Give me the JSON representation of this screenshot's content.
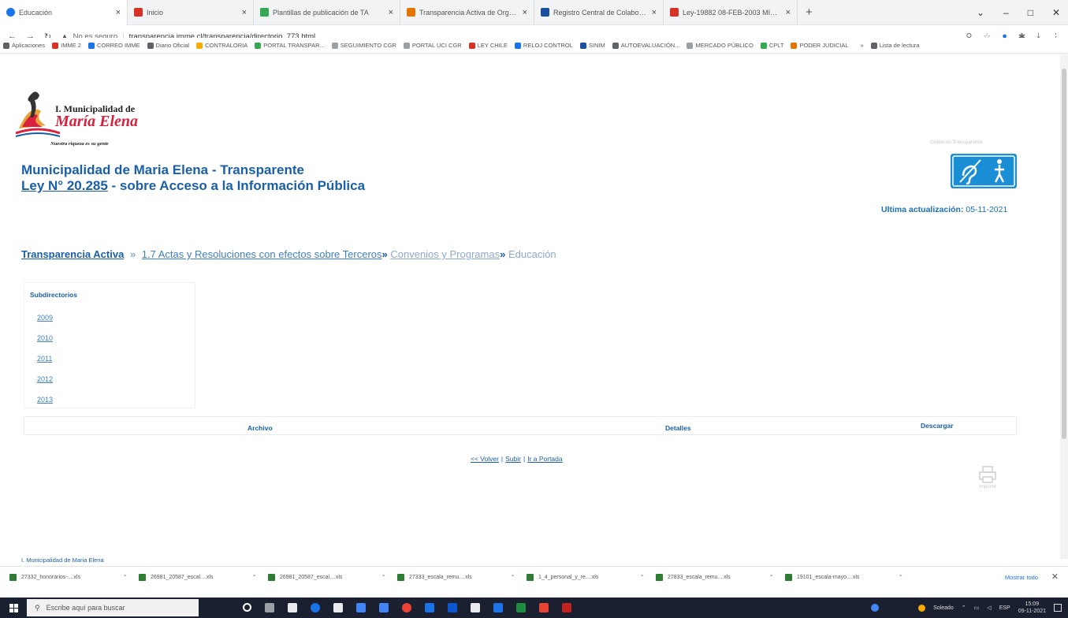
{
  "browser": {
    "tabs": [
      {
        "label": "Educación",
        "color": "#1a73e8"
      },
      {
        "label": "Inicio",
        "color": "#d93025"
      },
      {
        "label": "Plantillas de publicación de TA",
        "color": "#34a853"
      },
      {
        "label": "Transparencia Activa de Organis",
        "color": "#e37400"
      },
      {
        "label": "Registro Central de Colaborado",
        "color": "#1a4fa0"
      },
      {
        "label": "Ley-19882 08-FEB-2003 MINISTE",
        "color": "#d93025"
      }
    ],
    "new_tab": "+",
    "window_controls": {
      "minimize": "–",
      "maximize": "□",
      "close": "✕",
      "menu": "⌄"
    },
    "address": {
      "security": "No es seguro",
      "url": "transparencia.imme.cl/transparencia/directorio_773.html"
    },
    "bookmarks": [
      {
        "label": "Aplicaciones",
        "color": "#5f6368"
      },
      {
        "label": "IMME 2",
        "color": "#d93025"
      },
      {
        "label": "CORREO IMME",
        "color": "#1a73e8"
      },
      {
        "label": "Diario Oficial",
        "color": "#5f6368"
      },
      {
        "label": "CONTRALORIA",
        "color": "#f9ab00"
      },
      {
        "label": "PORTAL TRANSPAR...",
        "color": "#34a853"
      },
      {
        "label": "SEGUIMIENTO CGR",
        "color": "#9aa0a6"
      },
      {
        "label": "PORTAL UCI CGR",
        "color": "#9aa0a6"
      },
      {
        "label": "LEY CHILE",
        "color": "#d93025"
      },
      {
        "label": "RELOJ CONTROL",
        "color": "#1a73e8"
      },
      {
        "label": "SINIM",
        "color": "#1a4fa0"
      },
      {
        "label": "AUTOEVALUACIÓN...",
        "color": "#5f6368"
      },
      {
        "label": "MERCADO PÚBLICO",
        "color": "#9aa0a6"
      },
      {
        "label": "CPLT",
        "color": "#34a853"
      },
      {
        "label": "PODER JUDICIAL",
        "color": "#e37400"
      }
    ],
    "bookmarks_more": "»",
    "reading_list": "Lista de lectura"
  },
  "header": {
    "logo_line1": "I. Municipalidad de",
    "logo_line2": "María Elena",
    "logo_slogan": "Nuestra riqueza es su gente",
    "gov_text": "Gobierno Transparente",
    "title_line1": "Municipalidad de Maria Elena - Transparente",
    "title_law_link": "Ley N° 20.285",
    "title_line2_rest": " - sobre Acceso a la Información Pública",
    "updated_label": "Ultima actualización:",
    "updated_date": "05-11-2021"
  },
  "breadcrumb": {
    "item1": "Transparencia Activa",
    "sep1": "»",
    "item2": "1.7 Actas y Resoluciones con efectos sobre Terceros",
    "sep2": "»",
    "item3": "Convenios y Programas",
    "sep3": "»",
    "item4": "Educación"
  },
  "subdirectories": {
    "heading": "Subdirectorios",
    "years": [
      "2009",
      "2010",
      "2011",
      "2012",
      "2013"
    ]
  },
  "file_table": {
    "columns": [
      "Archivo",
      "Detalles",
      "Descargar"
    ]
  },
  "footer_links": {
    "back": "<< Volver",
    "up": "Subir",
    "home": "Ir a Portada",
    "sep": "|"
  },
  "print_label": "Imprimir",
  "page_footer": "I. Municipalidad de Maria Elena",
  "downloads": {
    "items": [
      "27332_honorarios-....xls",
      "26981_20587_escal....xls",
      "26981_20587_escal....xls",
      "27333_escala_remu....xls",
      "1_4_personal_y_re....xls",
      "27833_escala_remu....xls",
      "19101_escala-mayo....xls"
    ],
    "show_all": "Mostrar todo",
    "close": "✕"
  },
  "taskbar": {
    "search_placeholder": "Escribe aquí para buscar",
    "weather": "Soleado",
    "language": "ESP",
    "time": "15:09",
    "date": "09-11-2021"
  }
}
